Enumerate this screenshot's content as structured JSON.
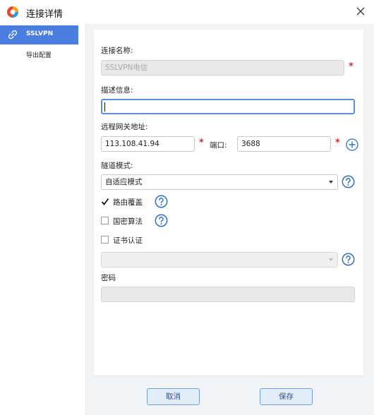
{
  "window": {
    "title": "连接详情"
  },
  "sidebar": {
    "items": [
      {
        "label": "SSLVPN",
        "active": true
      },
      {
        "label": "导出配置",
        "active": false
      }
    ]
  },
  "form": {
    "connection_name": {
      "label": "连接名称:",
      "value": "SSLVPN电信",
      "disabled": true,
      "required_mark": "*"
    },
    "description": {
      "label": "描述信息:",
      "value": ""
    },
    "remote_gateway": {
      "label": "远程网关地址:",
      "address": "113.108.41.94",
      "required_mark": "*",
      "port_label": "端口:",
      "port": "3688",
      "port_required_mark": "*"
    },
    "tunnel_mode": {
      "label": "隧道模式:",
      "selected": "自适应模式"
    },
    "route_override": {
      "label": "路由覆盖",
      "checked": true
    },
    "sm_algorithm": {
      "label": "国密算法",
      "checked": false
    },
    "cert_auth": {
      "label": "证书认证",
      "checked": false,
      "selected": ""
    },
    "password": {
      "label": "密码",
      "value": ""
    }
  },
  "buttons": {
    "cancel": "取消",
    "save": "保存"
  },
  "colors": {
    "accent": "#4a7de0",
    "required": "#d92b2b",
    "help": "#2f6fc0",
    "button_bg": "#e3ecf9"
  }
}
